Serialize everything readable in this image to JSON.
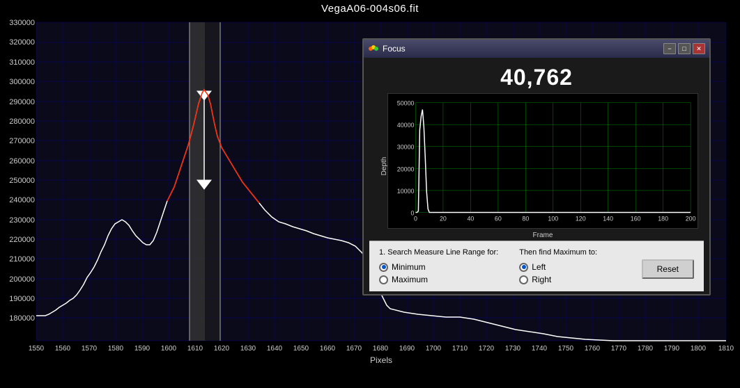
{
  "title": "VegaA06-004s06.fit",
  "focus_window": {
    "title": "Focus",
    "big_number": "40,762",
    "minimize_label": "−",
    "maximize_label": "□",
    "close_label": "✕",
    "inner_chart": {
      "y_label": "Depth",
      "x_label": "Frame",
      "y_max": "50000",
      "y_ticks": [
        "50000",
        "40000",
        "30000",
        "20000",
        "10000",
        "0"
      ],
      "x_ticks": [
        "0",
        "20",
        "40",
        "60",
        "80",
        "100",
        "120",
        "140",
        "160",
        "180",
        "200"
      ]
    },
    "controls": {
      "search_label": "1. Search Measure Line Range for:",
      "minimum_label": "Minimum",
      "maximum_label": "Maximum",
      "minimum_selected": true,
      "then_find_label": "Then find Maximum to:",
      "left_label": "Left",
      "right_label": "Right",
      "left_selected": true,
      "reset_label": "Reset"
    }
  },
  "main_chart": {
    "x_label": "Pixels",
    "y_ticks": [
      "330000",
      "320000",
      "310000",
      "300000",
      "290000",
      "280000",
      "270000",
      "260000",
      "250000",
      "240000",
      "230000",
      "220000",
      "210000",
      "200000",
      "190000",
      "180000"
    ],
    "x_ticks": [
      "1550",
      "1560",
      "1570",
      "1580",
      "1590",
      "1600",
      "1610",
      "1620",
      "1630",
      "1640",
      "1650",
      "1660",
      "1670",
      "1680",
      "1690",
      "1700",
      "1710",
      "1720",
      "1730",
      "1740",
      "1750",
      "1760",
      "1770",
      "1780",
      "1790",
      "1800",
      "1810"
    ]
  }
}
